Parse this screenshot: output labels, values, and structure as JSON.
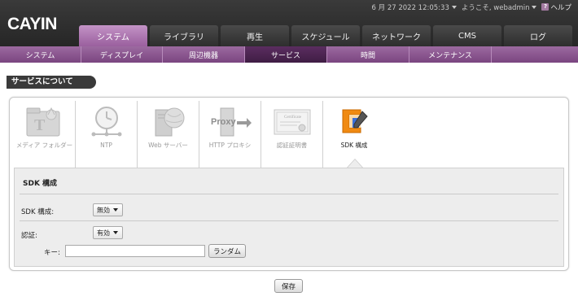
{
  "app": {
    "logo_text": "CAYIN"
  },
  "topbar": {
    "datetime": "6 月 27 2022 12:05:33",
    "welcome": "ようこそ, webadmin",
    "help_label": "ヘルプ"
  },
  "main_tabs": [
    {
      "label": "システム",
      "active": true
    },
    {
      "label": "ライブラリ"
    },
    {
      "label": "再生"
    },
    {
      "label": "スケジュール"
    },
    {
      "label": "ネットワーク"
    },
    {
      "label": "CMS"
    },
    {
      "label": "ログ"
    }
  ],
  "sub_tabs": [
    {
      "label": "システム"
    },
    {
      "label": "ディスプレイ"
    },
    {
      "label": "周辺機器"
    },
    {
      "label": "サービス",
      "active": true
    },
    {
      "label": "時間"
    },
    {
      "label": "メンテナンス"
    }
  ],
  "section_title": "サービスについて",
  "services": [
    {
      "label": "メディア フォルダー",
      "icon": "media-folder-icon"
    },
    {
      "label": "NTP",
      "icon": "clock-icon"
    },
    {
      "label": "Web サーバー",
      "icon": "web-server-icon"
    },
    {
      "label": "HTTP プロキシ",
      "icon": "proxy-icon",
      "icon_text": "Proxy"
    },
    {
      "label": "認証証明書",
      "icon": "certificate-icon",
      "icon_text": "Certificate"
    },
    {
      "label": "SDK 構成",
      "icon": "sdk-tools-icon",
      "active": true
    }
  ],
  "sdk_config": {
    "title": "SDK 構成",
    "sdk_label": "SDK 構成:",
    "sdk_value": "無効",
    "auth_label": "認証:",
    "auth_value": "有効",
    "key_label": "キー:",
    "key_value": "",
    "random_button": "ランダム"
  },
  "save_button": "保存",
  "colors": {
    "header_bg": "#2e2e2e",
    "active_tab": "#a46aa8",
    "subnav_bg": "#8a5490",
    "subnav_active": "#4a2350",
    "config_bg": "#ededed"
  }
}
